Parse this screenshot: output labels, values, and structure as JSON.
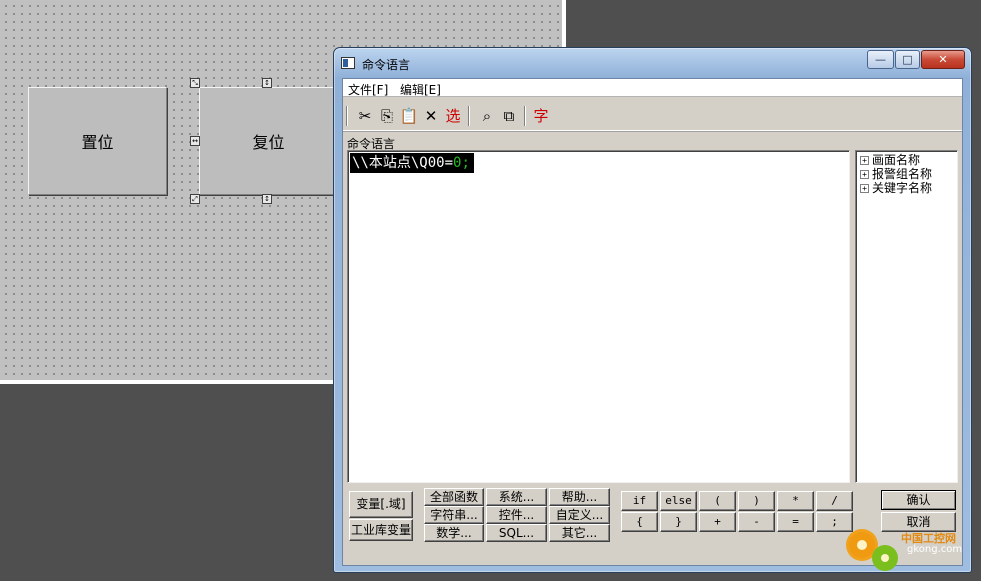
{
  "canvas": {
    "buttons": [
      {
        "label": "置位"
      },
      {
        "label": "复位"
      }
    ]
  },
  "dialog": {
    "title": "命令语言",
    "caption_buttons": {
      "minimize": "—",
      "maximize": "□",
      "close": "✕"
    },
    "menu": [
      "文件[F]",
      "编辑[E]"
    ],
    "toolbar": [
      {
        "icon": "cut-icon"
      },
      {
        "icon": "copy-icon"
      },
      {
        "icon": "paste-icon"
      },
      {
        "icon": "delete-icon"
      },
      {
        "label": "选",
        "icon": "select-icon"
      },
      {
        "icon": "find-icon"
      },
      {
        "icon": "replace-icon"
      },
      {
        "label": "字",
        "icon": "font-icon"
      }
    ],
    "section_label": "命令语言",
    "code": {
      "prefix": "\\\\本站点\\Q00=",
      "zero": "0",
      "semi": ";"
    },
    "tree": [
      "画面名称",
      "报警组名称",
      "关键字名称"
    ],
    "buttons": {
      "variable": "变量[.域]",
      "industrial_var": "工业库变量",
      "functions": [
        [
          "全部函数",
          "系统...",
          "帮助..."
        ],
        [
          "字符串...",
          "控件...",
          "自定义..."
        ],
        [
          "数学...",
          "SQL...",
          "其它..."
        ]
      ],
      "keywords": [
        [
          "if",
          "else",
          "(",
          ")",
          "*",
          "/"
        ],
        [
          "{",
          "}",
          "+",
          "-",
          "=",
          ";"
        ]
      ],
      "confirm": "确认",
      "cancel": "取消"
    }
  },
  "watermark": {
    "title": "中国工控网",
    "url": "gkong.com"
  }
}
